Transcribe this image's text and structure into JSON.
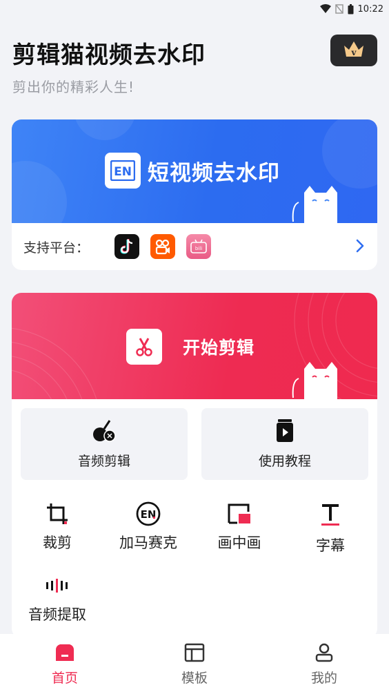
{
  "status_bar": {
    "time": "10:22"
  },
  "header": {
    "title": "剪辑猫视频去水印",
    "subtitle": "剪出你的精彩人生!",
    "vip_badge_icon": "vip-crown-icon"
  },
  "watermark_card": {
    "banner_icon_text": "EN",
    "banner_title": "短视频去水印",
    "platform_label": "支持平台：",
    "platforms": [
      {
        "name": "douyin",
        "icon": "tiktok-icon",
        "color": "#111111"
      },
      {
        "name": "kuaishou",
        "icon": "kuaishou-icon",
        "color": "#ff5a00"
      },
      {
        "name": "bilibili",
        "icon": "bilibili-icon",
        "color": "#f57396"
      }
    ],
    "more_icon": "chevron-right-icon"
  },
  "edit_card": {
    "banner_title": "开始剪辑",
    "big_tiles": [
      {
        "label": "音频剪辑",
        "icon": "audio-edit-icon"
      },
      {
        "label": "使用教程",
        "icon": "tutorial-icon"
      }
    ],
    "tools": [
      {
        "label": "裁剪",
        "icon": "crop-icon"
      },
      {
        "label": "加马赛克",
        "icon": "mosaic-icon"
      },
      {
        "label": "画中画",
        "icon": "picture-in-picture-icon"
      },
      {
        "label": "字幕",
        "icon": "subtitle-icon"
      },
      {
        "label": "音频提取",
        "icon": "audio-extract-icon"
      }
    ]
  },
  "bottom_nav": {
    "items": [
      {
        "label": "首页",
        "icon": "home-icon",
        "active": true
      },
      {
        "label": "模板",
        "icon": "template-icon",
        "active": false
      },
      {
        "label": "我的",
        "icon": "profile-icon",
        "active": false
      }
    ]
  },
  "colors": {
    "accent": "#ef2c52",
    "blue": "#2f6ef1"
  }
}
